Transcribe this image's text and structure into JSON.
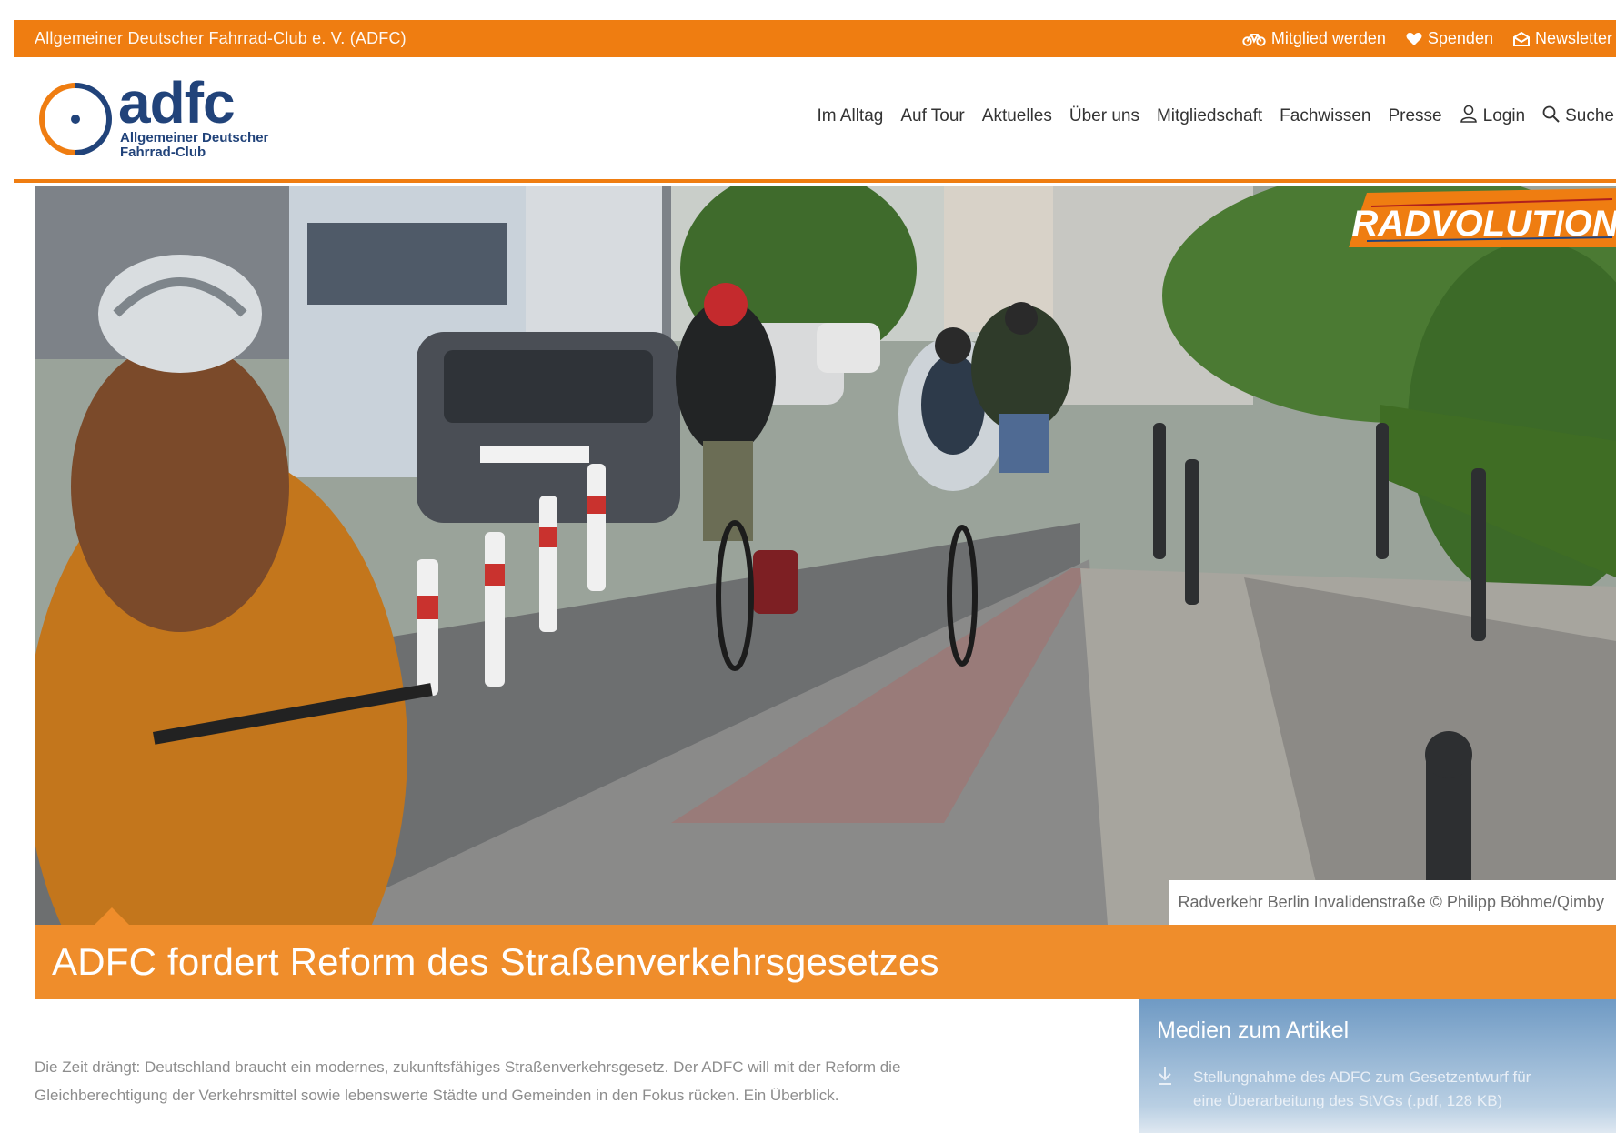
{
  "topbar": {
    "org_name": "Allgemeiner Deutscher Fahrrad-Club e. V. (ADFC)",
    "links": [
      {
        "label": "Mitglied werden",
        "icon": "bicycle-icon"
      },
      {
        "label": "Spenden",
        "icon": "heart-icon"
      },
      {
        "label": "Newsletter",
        "icon": "mail-icon"
      }
    ],
    "color": "#ef7d11"
  },
  "logo": {
    "word": "adfc",
    "subtitle": "Allgemeiner Deutscher\nFahrrad-Club"
  },
  "nav": {
    "items": [
      "Im Alltag",
      "Auf Tour",
      "Aktuelles",
      "Über uns",
      "Mitgliedschaft",
      "Fachwissen",
      "Presse"
    ],
    "login_label": "Login",
    "search_label": "Suche"
  },
  "hero": {
    "brand": "RADVOLUTION",
    "caption": "Radverkehr Berlin Invalidenstraße © Philipp Böhme/Qimby"
  },
  "article": {
    "title": "ADFC fordert Reform des Straßenverkehrsgesetzes",
    "intro_line1": "Die Zeit drängt: Deutschland braucht ein modernes, zukunftsfähiges Straßenverkehrsgesetz. Der ADFC will mit der Reform die",
    "intro_line2": "Gleichberechtigung der Verkehrsmittel sowie lebenswerte Städte und Gemeinden in den Fokus rücken. Ein Überblick."
  },
  "media": {
    "heading": "Medien zum Artikel",
    "doc_line1": "Stellungnahme des ADFC zum Gesetzentwurf für",
    "doc_line2": "eine Überarbeitung des StVGs (.pdf, 128 KB)",
    "doc_icon": "download-icon"
  }
}
